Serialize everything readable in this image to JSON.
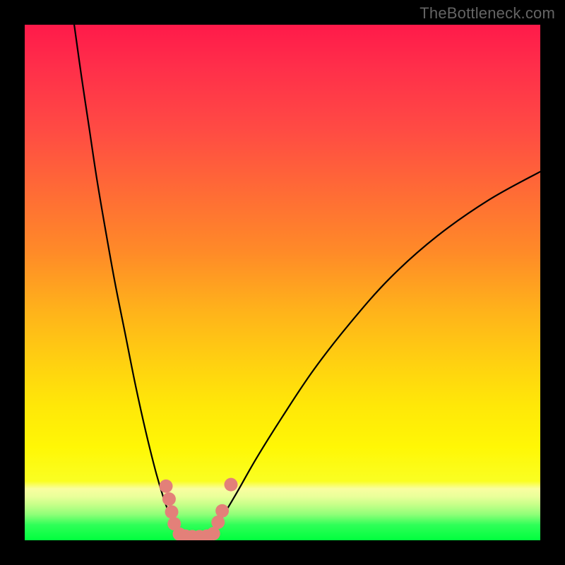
{
  "watermark": "TheBottleneck.com",
  "chart_data": {
    "type": "line",
    "title": "",
    "xlabel": "",
    "ylabel": "",
    "xlim": [
      0,
      100
    ],
    "ylim": [
      0,
      100
    ],
    "series": [
      {
        "name": "bottleneck-curve-left",
        "x": [
          9.6,
          11.0,
          12.5,
          14.0,
          15.7,
          17.5,
          19.5,
          21.5,
          23.5,
          25.5,
          27.0,
          28.5,
          30.0
        ],
        "values": [
          100,
          90.0,
          80.0,
          70.0,
          60.0,
          50.0,
          40.0,
          30.0,
          21.0,
          13.0,
          8.0,
          4.0,
          1.0
        ]
      },
      {
        "name": "bottleneck-curve-right",
        "x": [
          36.0,
          38.0,
          41.0,
          45.0,
          50.0,
          56.0,
          63.0,
          71.0,
          80.0,
          90.0,
          100.0
        ],
        "values": [
          1.0,
          4.0,
          9.0,
          16.0,
          24.0,
          33.0,
          42.0,
          51.0,
          59.0,
          66.0,
          71.5
        ]
      },
      {
        "name": "salmon-marker-left-cluster",
        "x": [
          27.4,
          28.0,
          28.5,
          29.0
        ],
        "values": [
          10.5,
          8.0,
          5.5,
          3.2
        ]
      },
      {
        "name": "salmon-marker-bottom-row",
        "x": [
          30.0,
          31.2,
          32.5,
          33.9,
          35.3,
          36.6
        ],
        "values": [
          1.2,
          0.8,
          0.7,
          0.7,
          0.8,
          1.3
        ]
      },
      {
        "name": "salmon-marker-right-cluster",
        "x": [
          37.5,
          38.3,
          40.0
        ],
        "values": [
          3.5,
          5.7,
          10.8
        ]
      }
    ],
    "colors": {
      "curve": "#000000",
      "markers": "#e38079",
      "gradient_top": "#ff1a4a",
      "gradient_mid": "#ffe808",
      "gradient_bottom": "#00ff3e"
    }
  }
}
